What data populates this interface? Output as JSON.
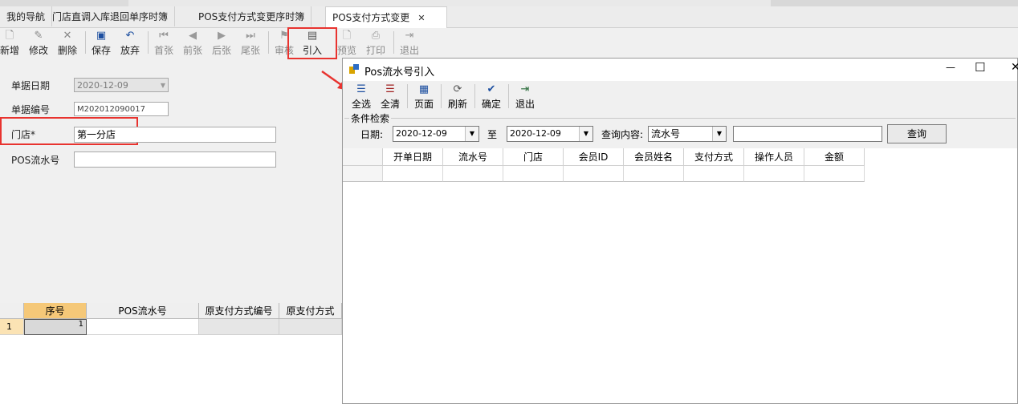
{
  "tabs": [
    {
      "label": "我的导航"
    },
    {
      "label": "门店直调入库退回单序时簿"
    },
    {
      "label": "POS支付方式变更序时簿"
    },
    {
      "label": "POS支付方式变更",
      "close": "✕"
    }
  ],
  "toolbar": {
    "buttons": [
      {
        "label": "新增",
        "icon": "new-doc-icon"
      },
      {
        "label": "修改",
        "icon": "edit-icon"
      },
      {
        "label": "删除",
        "icon": "delete-icon"
      },
      {
        "label": "保存",
        "icon": "save-icon"
      },
      {
        "label": "放弃",
        "icon": "undo-icon"
      },
      {
        "label": "首张",
        "icon": "first-icon"
      },
      {
        "label": "前张",
        "icon": "prev-icon"
      },
      {
        "label": "后张",
        "icon": "next-icon"
      },
      {
        "label": "尾张",
        "icon": "last-icon"
      },
      {
        "label": "审核",
        "icon": "audit-icon"
      },
      {
        "label": "引入",
        "icon": "import-icon"
      },
      {
        "label": "预览",
        "icon": "preview-icon"
      },
      {
        "label": "打印",
        "icon": "print-icon"
      },
      {
        "label": "退出",
        "icon": "exit-icon"
      }
    ]
  },
  "form": {
    "date_label": "单据日期",
    "date_value": "2020-12-09",
    "number_label": "单据编号",
    "number_value": "M202012090017",
    "store_label": "门店*",
    "store_value": "第一分店",
    "pos_label": "POS流水号",
    "pos_value": ""
  },
  "grid": {
    "columns": [
      "序号",
      "POS流水号",
      "原支付方式编号",
      "原支付方式"
    ],
    "rows": [
      {
        "row_header": "1",
        "seq": "1"
      }
    ]
  },
  "dialog": {
    "title": "Pos流水号引入",
    "min": "—",
    "max": "☐",
    "close": "✕",
    "toolbar": [
      {
        "label": "全选",
        "icon": "select-all-icon"
      },
      {
        "label": "全清",
        "icon": "clear-all-icon"
      },
      {
        "label": "页面",
        "icon": "page-icon"
      },
      {
        "label": "刷新",
        "icon": "refresh-icon"
      },
      {
        "label": "确定",
        "icon": "confirm-icon"
      },
      {
        "label": "退出",
        "icon": "exit-icon"
      }
    ],
    "filter": {
      "group_title": "条件检索",
      "date_label": "日期:",
      "date_from": "2020-12-09",
      "to_label": "至",
      "date_to": "2020-12-09",
      "query_label": "查询内容:",
      "query_field": "流水号",
      "query_text": "",
      "query_button": "查询"
    },
    "columns": [
      "开单日期",
      "流水号",
      "门店",
      "会员ID",
      "会员姓名",
      "支付方式",
      "操作人员",
      "金额"
    ]
  },
  "colors": {
    "highlight_red": "#e8332f",
    "selected_header": "#f5c878"
  }
}
